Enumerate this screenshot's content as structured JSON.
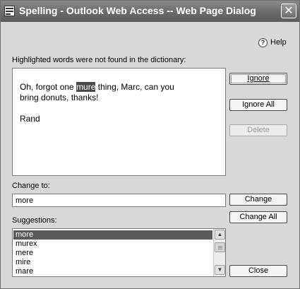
{
  "window": {
    "title": "Spelling - Outlook Web Access -- Web Page Dialog",
    "close_glyph": "✕"
  },
  "help": {
    "label": "Help",
    "icon": "help-icon",
    "glyph": "?"
  },
  "notice": "Highlighted words were not found in the dictionary:",
  "message": {
    "line1_before": "Oh, forgot one ",
    "highlighted_word": "mure",
    "line1_after": " thing, Marc, can you",
    "line2": "bring donuts, thanks!",
    "line3": "Rand"
  },
  "buttons": {
    "ignore": {
      "label": "Ignore"
    },
    "ignore_all": {
      "label": "Ignore All"
    },
    "delete": {
      "label": "Delete",
      "disabled": true
    },
    "change": {
      "label": "Change"
    },
    "change_all": {
      "label": "Change All"
    },
    "close": {
      "label": "Close"
    }
  },
  "change_to": {
    "label": "Change to:",
    "value": "more"
  },
  "suggestions": {
    "label": "Suggestions:",
    "items": [
      "more",
      "murex",
      "mere",
      "mire",
      "mare"
    ],
    "selected_index": 0
  },
  "colors": {
    "titlebar": "#6a6a6a",
    "dialog_bg": "#d8d8d8",
    "highlight": "#4a4a4a"
  }
}
